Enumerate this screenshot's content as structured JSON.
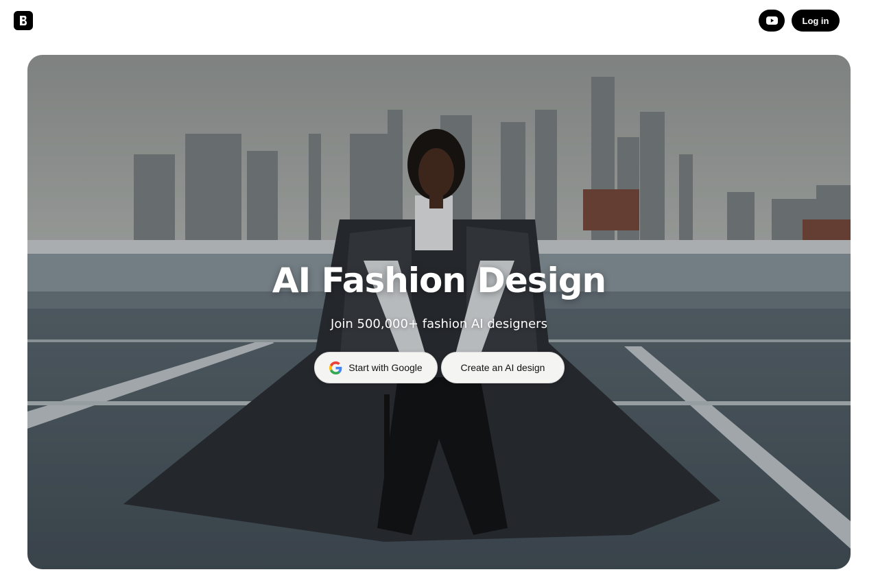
{
  "header": {
    "logo_icon": "brand-logo-icon",
    "youtube_icon": "youtube-icon",
    "login_label": "Log in"
  },
  "hero": {
    "title": "AI Fashion Design",
    "subtitle": "Join 500,000+ fashion AI designers",
    "google_button_label": "Start with Google",
    "google_icon": "google-icon",
    "create_button_label": "Create an AI design"
  },
  "colors": {
    "brand_black": "#000000",
    "button_light": "#f4f4f2",
    "text_white": "#ffffff"
  }
}
